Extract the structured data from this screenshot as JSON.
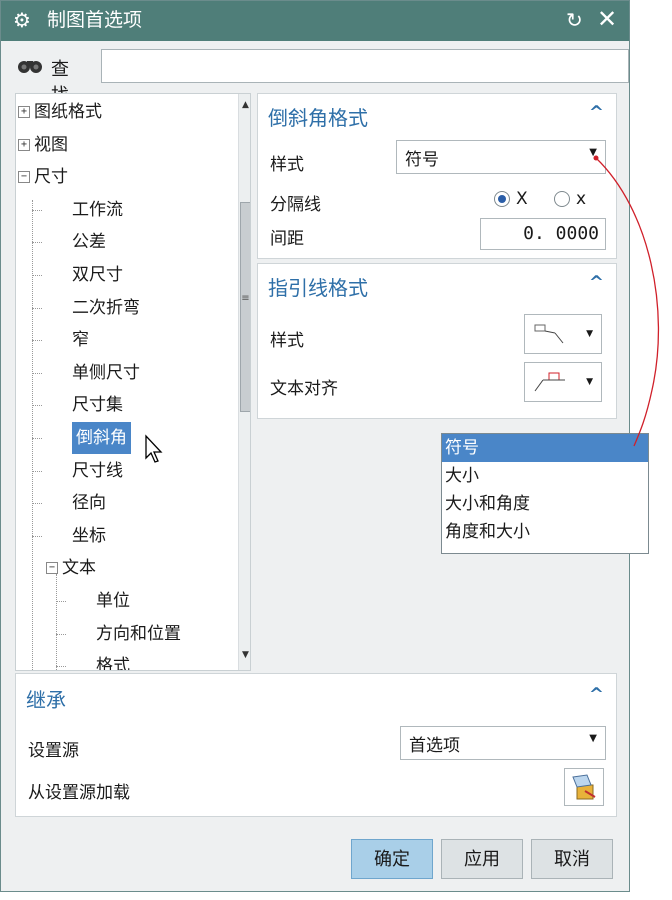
{
  "window": {
    "title": "制图首选项",
    "title_icon": "gear-icon",
    "reset_icon": "↻",
    "close_icon": "✕"
  },
  "search": {
    "label": "查找",
    "value": "",
    "placeholder": ""
  },
  "tree": {
    "items": [
      {
        "label": "图纸格式",
        "expander": "+"
      },
      {
        "label": "视图",
        "expander": "+"
      },
      {
        "label": "尺寸",
        "expander": "−"
      },
      {
        "label": "工作流"
      },
      {
        "label": "公差"
      },
      {
        "label": "双尺寸"
      },
      {
        "label": "二次折弯"
      },
      {
        "label": "窄"
      },
      {
        "label": "单侧尺寸"
      },
      {
        "label": "尺寸集"
      },
      {
        "label": "倒斜角",
        "selected": true
      },
      {
        "label": "尺寸线"
      },
      {
        "label": "径向"
      },
      {
        "label": "坐标"
      },
      {
        "label": "文本",
        "expander": "−"
      },
      {
        "label": "单位"
      },
      {
        "label": "方向和位置"
      },
      {
        "label": "格式"
      }
    ]
  },
  "chamfer_format": {
    "title": "倒斜角格式",
    "style_label": "样式",
    "style_value": "符号",
    "separator_label": "分隔线",
    "radio_upper": "X",
    "radio_lower": "x",
    "spacing_label": "间距",
    "spacing_value": "0. 0000"
  },
  "leader_format": {
    "title": "指引线格式",
    "style_label": "样式",
    "text_align_label": "文本对齐"
  },
  "style_dropdown": {
    "options": [
      "符号",
      "大小",
      "大小和角度",
      "角度和大小"
    ],
    "selected": "符号"
  },
  "inherit": {
    "title": "继承",
    "source_label": "设置源",
    "source_value": "首选项",
    "load_label": "从设置源加载"
  },
  "buttons": {
    "ok": "确定",
    "apply": "应用",
    "cancel": "取消"
  },
  "colors": {
    "titlebar": "#4f7e79",
    "accent": "#2e6fa8",
    "selection": "#4a86c8",
    "annotation_arrow": "#d0202a"
  }
}
